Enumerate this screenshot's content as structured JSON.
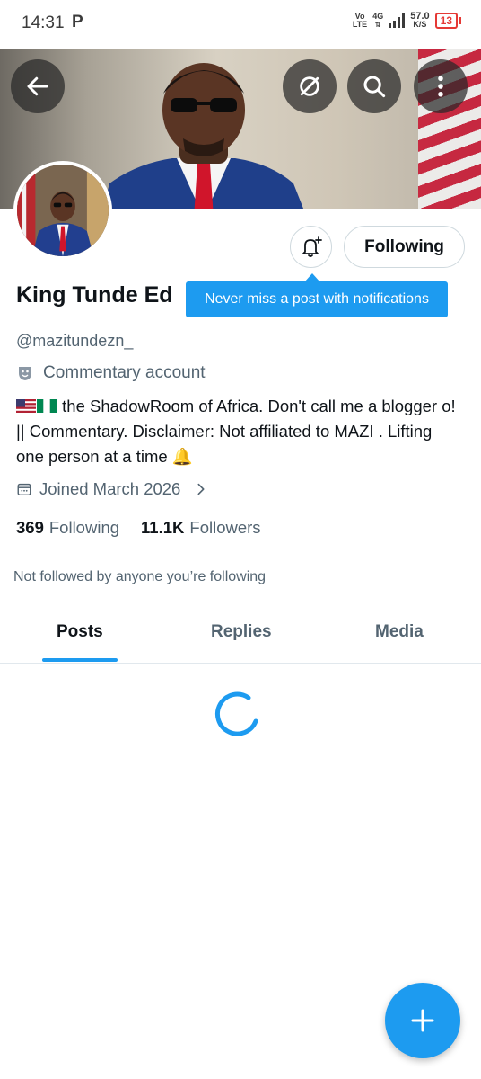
{
  "status_bar": {
    "time": "14:31",
    "notification_glyph": "P",
    "volte": "Vo\nLTE",
    "network": "4G",
    "speed_value": "57.0",
    "speed_unit": "K/S",
    "battery": "13"
  },
  "header": {
    "back_icon": "arrow-left-icon",
    "grok_icon": "slashed-circle-icon",
    "search_icon": "search-icon",
    "more_icon": "more-vertical-icon"
  },
  "profile": {
    "display_name": "King Tunde Ed",
    "handle": "@mazitundezn_",
    "account_label": "Commentary account",
    "bio_text": " the ShadowRoom of Africa. Don't call me a blogger o! || Commentary. Disclaimer: Not affiliated to MAZI . Lifting one person at a time ",
    "bio_end_emoji": "🔔",
    "joined": "Joined March 2026",
    "following_count": "369",
    "following_label": "Following",
    "followers_count": "11.1K",
    "followers_label": "Followers",
    "not_followed": "Not followed by anyone you’re following"
  },
  "actions": {
    "following_button": "Following",
    "tooltip": "Never miss a post with notifications"
  },
  "tabs": [
    {
      "label": "Posts",
      "active": true
    },
    {
      "label": "Replies",
      "active": false
    },
    {
      "label": "Media",
      "active": false
    }
  ],
  "colors": {
    "accent": "#1d9bf0",
    "text_primary": "#0f1419",
    "text_secondary": "#536471",
    "battery_low": "#e53935"
  }
}
